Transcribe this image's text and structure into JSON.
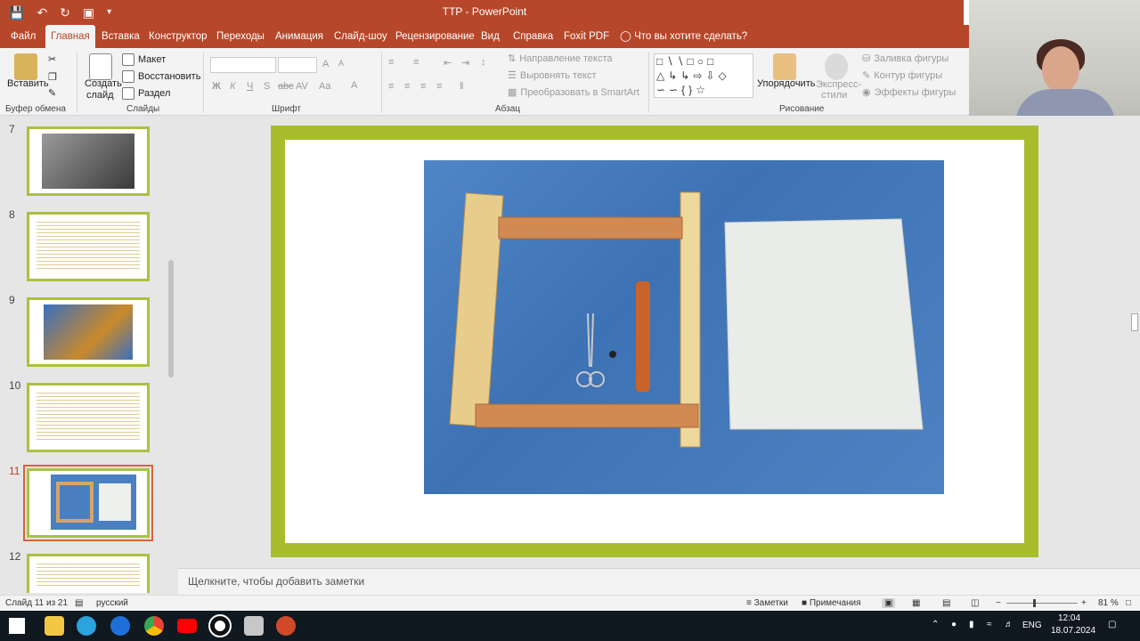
{
  "window": {
    "title": "TTP  -  PowerPoint"
  },
  "qat": {
    "save_icon": "save-icon",
    "undo_icon": "undo-icon",
    "redo_icon": "redo-icon",
    "present_icon": "present-icon",
    "customize_icon": "chevron-down-icon"
  },
  "tabs": [
    "Файл",
    "Главная",
    "Вставка",
    "Конструктор",
    "Переходы",
    "Анимация",
    "Слайд-шоу",
    "Рецензирование",
    "Вид",
    "Справка",
    "Foxit PDF"
  ],
  "active_tab": "Главная",
  "tell_me": "Что вы хотите сделать?",
  "ribbon": {
    "clipboard": {
      "paste": "Вставить",
      "label": "Буфер обмена"
    },
    "slides": {
      "new_slide_1": "Создать",
      "new_slide_2": "слайд",
      "layout": "Макет",
      "reset": "Восстановить",
      "section": "Раздел",
      "label": "Слайды"
    },
    "font": {
      "bold": "Ж",
      "italic": "К",
      "underline": "Ч",
      "shadow": "S",
      "strike": "abc",
      "spacing": "AV",
      "case": "Aa",
      "color": "A",
      "grow": "A",
      "shrink": "A",
      "label": "Шрифт"
    },
    "paragraph": {
      "text_direction": "Направление текста",
      "align_text": "Выровнять текст",
      "smartart": "Преобразовать в SmartArt",
      "label": "Абзац"
    },
    "drawing": {
      "arrange": "Упорядочить",
      "quick_styles_1": "Экспресс-",
      "quick_styles_2": "стили",
      "fill": "Заливка фигуры",
      "outline": "Контур фигуры",
      "effects": "Эффекты фигуры",
      "label": "Рисование"
    }
  },
  "thumbnails": [
    {
      "num": "7",
      "kind": "photo"
    },
    {
      "num": "8",
      "kind": "text"
    },
    {
      "num": "9",
      "kind": "photo-color"
    },
    {
      "num": "10",
      "kind": "text"
    },
    {
      "num": "11",
      "kind": "photo-frame",
      "selected": true
    },
    {
      "num": "12",
      "kind": "text"
    }
  ],
  "notes_placeholder": "Щелкните, чтобы добавить заметки",
  "status": {
    "slide_info": "Слайд 11 из 21",
    "language": "русский",
    "notes": "Заметки",
    "comments": "Примечания",
    "zoom": "81 %"
  },
  "taskbar": {
    "lang": "ENG",
    "time": "12:04",
    "date": "18.07.2024",
    "apps": [
      "windows-icon",
      "file-explorer-icon",
      "telegram-icon",
      "teamviewer-icon",
      "chrome-icon",
      "youtube-icon",
      "recorder-icon",
      "presentation-viewer-icon",
      "powerpoint-icon"
    ]
  },
  "colors": {
    "accent": "#b7472a",
    "slide_border": "#a7bd2c",
    "thumb_border": "#a9c23f",
    "selection": "#d8613c",
    "taskbar": "#101820"
  }
}
